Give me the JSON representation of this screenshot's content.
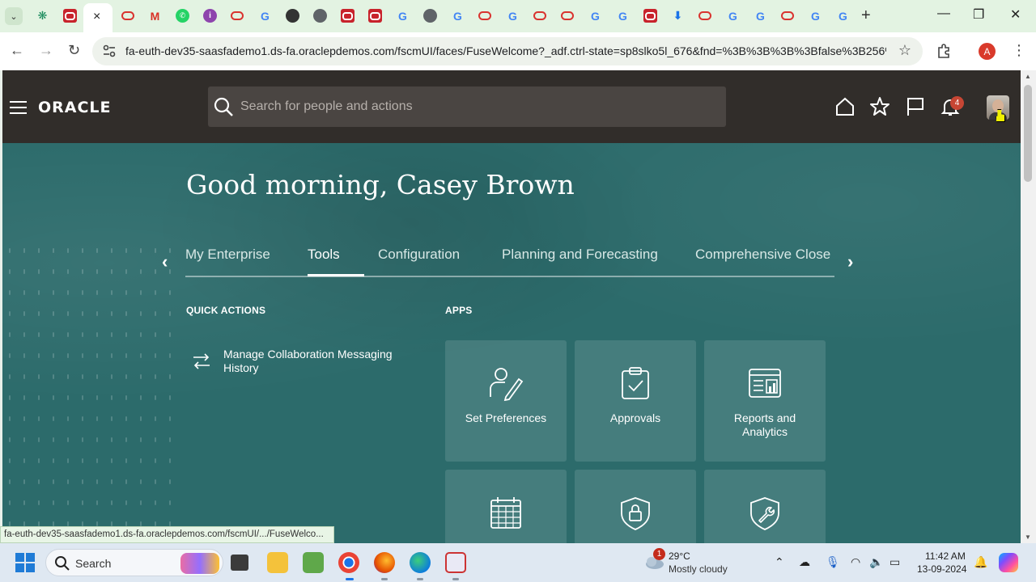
{
  "browser": {
    "active_tab_close": "×",
    "new_tab": "+",
    "url": "fa-euth-dev35-saasfademo1.ds-fa.oraclepdemos.com/fscmUI/faces/FuseWelcome?_adf.ctrl-state=sp8slko5l_676&fnd=%3B%3B%3B%3Bfalse%3B256%...",
    "profile_initial": "A",
    "status_link": "fa-euth-dev35-saasfademo1.ds-fa.oraclepdemos.com/fscmUI/.../FuseWelco..."
  },
  "header": {
    "logo": "ORACLE",
    "search_placeholder": "Search for people and actions",
    "notification_count": "4"
  },
  "greeting": "Good morning, Casey Brown",
  "tabs": [
    {
      "label": "My Enterprise"
    },
    {
      "label": "Tools"
    },
    {
      "label": "Configuration"
    },
    {
      "label": "Planning and Forecasting"
    },
    {
      "label": "Comprehensive Close"
    }
  ],
  "active_tab": "Tools",
  "quick_actions": {
    "title": "QUICK ACTIONS",
    "items": [
      {
        "label": "Manage Collaboration Messaging History"
      }
    ]
  },
  "apps": {
    "title": "APPS",
    "tiles": [
      {
        "label": "Set Preferences",
        "icon": "user-edit-icon"
      },
      {
        "label": "Approvals",
        "icon": "clipboard-check-icon"
      },
      {
        "label": "Reports and Analytics",
        "icon": "reports-icon"
      },
      {
        "label": "",
        "icon": "calendar-icon"
      },
      {
        "label": "",
        "icon": "shield-lock-icon"
      },
      {
        "label": "",
        "icon": "shield-wrench-icon"
      }
    ]
  },
  "taskbar": {
    "search_label": "Search",
    "weather_badge": "1",
    "temperature": "29°C",
    "weather_desc": "Mostly cloudy",
    "time": "11:42 AM",
    "date": "13-09-2024"
  },
  "colors": {
    "header_bg": "#312d2a",
    "teal_bg": "#2c6b6b",
    "badge_red": "#c74634"
  }
}
